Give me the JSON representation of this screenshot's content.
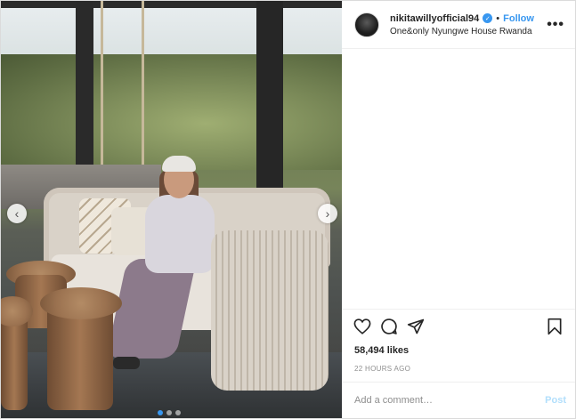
{
  "header": {
    "username": "nikitawillyofficial94",
    "verified_icon": "✓",
    "separator": "•",
    "follow_label": "Follow",
    "location": "One&only Nyungwe House Rwanda",
    "more_icon": "•••"
  },
  "carousel": {
    "prev_icon": "‹",
    "next_icon": "›",
    "slide_count": 3,
    "active_slide": 1
  },
  "actions": {
    "like_icon": "heart-icon",
    "comment_icon": "comment-icon",
    "share_icon": "share-icon",
    "save_icon": "bookmark-icon"
  },
  "likes": "58,494 likes",
  "timestamp": "22 HOURS AGO",
  "comment": {
    "placeholder": "Add a comment…",
    "post_label": "Post"
  },
  "colors": {
    "accent": "#3897f0",
    "muted": "#8e8e8e",
    "post_disabled": "#b2dffc",
    "border": "#dbdbdb"
  }
}
